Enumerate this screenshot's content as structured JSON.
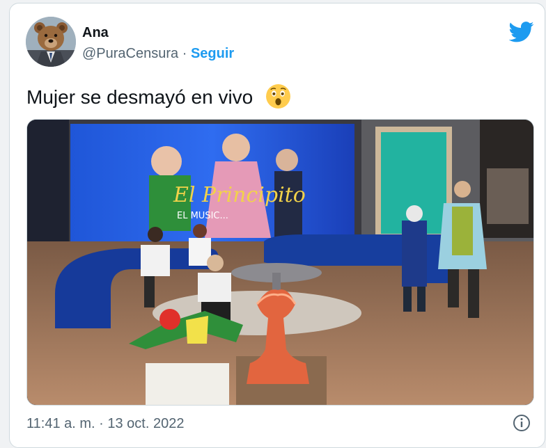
{
  "tweet": {
    "author_name": "Ana",
    "author_handle": "@PuraCensura",
    "separator": "·",
    "follow_label": "Seguir",
    "text": "Mujer se desmayó en vivo",
    "emoji": "astonished-face-emoji",
    "timestamp": "11:41 a. m. · 13 oct. 2022"
  },
  "media": {
    "show_title": "El Principito",
    "show_subtitle": "EL MUSIC..."
  },
  "icons": {
    "brand": "twitter-bird-icon",
    "info": "info-icon",
    "avatar": "teddy-bear-avatar"
  },
  "colors": {
    "accent": "#1d9bf0",
    "text_primary": "#0f1419",
    "text_secondary": "#536471",
    "border": "#cfd9de"
  }
}
